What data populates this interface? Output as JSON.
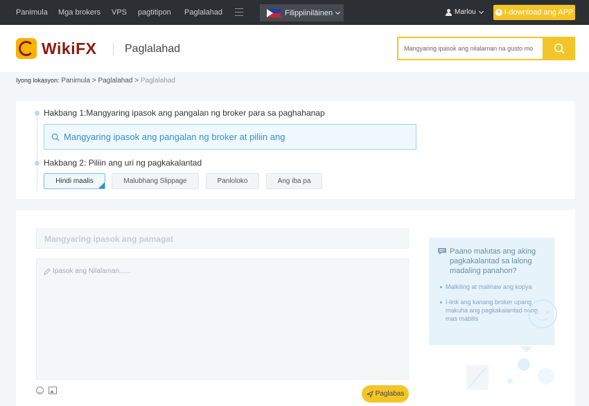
{
  "topnav": {
    "items": [
      "Panimula",
      "Mga brokers",
      "VPS",
      "pagtitipon",
      "Paglalahad"
    ],
    "language": "Filippiiniläinen",
    "user": "Marlou",
    "download_label": "I-download ang APP"
  },
  "header": {
    "logo": "WikiFX",
    "title": "Paglalahad",
    "search_placeholder": "Mangyaring ipasok ang nilalaman na gusto mo"
  },
  "breadcrumb": {
    "prefix": "Iyong lokasyon:",
    "items": [
      "Panimula",
      "Paglalahad",
      "Paglalahad"
    ],
    "separator": ">"
  },
  "steps": {
    "step1_label": "Hakbang 1:Mangyaring ipasok ang pangalan ng broker para sa paghahanap",
    "broker_placeholder": "Mangyaring ipasok ang pangalan ng broker at piliin ang",
    "step2_label": "Hakbang 2: Piliin ang uri ng pagkakalantad",
    "types": [
      "Hindi maalis",
      "Malubhang Slippage",
      "Panloloko",
      "Ang iba pa"
    ]
  },
  "compose": {
    "title_placeholder": "Mangyaring ipasok ang pamagat",
    "content_placeholder": "Ipasok ang Nilalaman......",
    "submit_label": "Paglabas"
  },
  "tips": {
    "heading": "Paano malutas ang aking pagkakalantad sa lalong madaling panahon?",
    "items": [
      "Malkiling at malinaw ang kopya",
      "I-link ang kanang broker upang makuha ang pagkakalantad nang mas mabilis"
    ]
  },
  "colors": {
    "accent": "#f4c528",
    "nav_bg": "#2c3034",
    "brand": "#8b1a0f",
    "link_blue": "#3a8dd0"
  }
}
